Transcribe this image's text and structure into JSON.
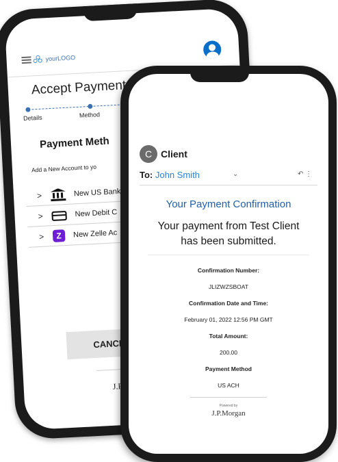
{
  "back_screen": {
    "logo_text": "yourLOGO",
    "title": "Accept Payment",
    "steps": [
      "Details",
      "Method"
    ],
    "section_heading": "Payment Meth",
    "subtext": "Add a New Account to yo",
    "options": [
      {
        "icon": "bank-icon",
        "label": "New US Bank"
      },
      {
        "icon": "card-icon",
        "label": "New Debit C"
      },
      {
        "icon": "zelle-icon",
        "label": "New Zelle Ac"
      }
    ],
    "zelle_glyph": "Z",
    "cancel_label": "CANCEL",
    "powered_by": "Po",
    "brand": "J.P.M"
  },
  "front_screen": {
    "sender_initial": "C",
    "sender_name": "Client",
    "to_label": "To:",
    "to_name": "John Smith",
    "heading": "Your Payment Confirmation",
    "message_line1": "Your payment from Test Client",
    "message_line2": "has been submitted.",
    "details": [
      {
        "label": "Confirmation Number:",
        "value": "JLIZWZSBOAT"
      },
      {
        "label": "Confirmation Date and Time:",
        "value": "February 01, 2022 12:56 PM GMT"
      },
      {
        "label": "Total Amount:",
        "value": "200.00"
      },
      {
        "label": "Payment Method",
        "value": "US ACH"
      }
    ],
    "powered_by": "Powered by",
    "brand": "J.P.Morgan"
  },
  "colors": {
    "accent_blue": "#1f5fa8",
    "link_blue": "#2b83d0",
    "zelle_purple": "#6d1ed4"
  }
}
